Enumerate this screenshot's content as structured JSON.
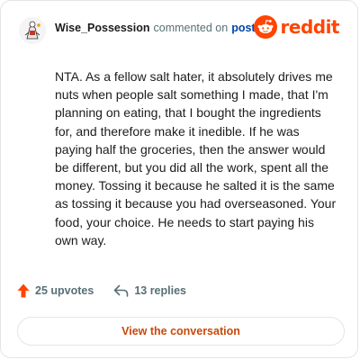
{
  "header": {
    "username": "Wise_Possession",
    "action_text": "commented on",
    "post_link": "post",
    "brand_name": "reddit"
  },
  "comment": {
    "body": "NTA. As a fellow salt hater, it absolutely drives me nuts when people salt something I made, that I'm planning on eating, that I bought the ingredients for, and therefore make it inedible. If he was paying half the groceries, then the answer would be different, but you did all the work, spent all the money. Tossing it because he salted it is the same as tossing it because you had overseasoned. Your food, your choice. He needs to start paying his own way."
  },
  "footer": {
    "upvotes": "25 upvotes",
    "replies": "13 replies"
  },
  "cta": {
    "label": "View the conversation"
  },
  "icons": {
    "avatar": "avatar-icon",
    "brand": "reddit-snoo-icon",
    "upvote": "upvote-arrow-icon",
    "reply": "reply-arrow-icon"
  },
  "colors": {
    "brand_orange": "#ff4500",
    "link_blue": "#0045ac",
    "cta_text": "#c8490a",
    "muted": "#576f76",
    "border": "#e3e5e8"
  }
}
